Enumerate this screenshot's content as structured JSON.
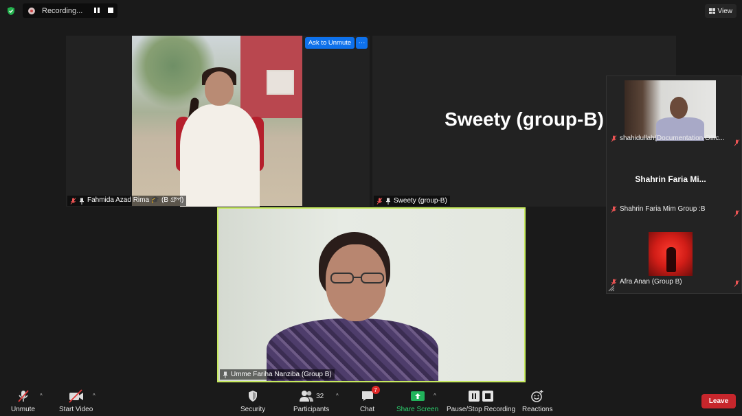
{
  "top_bar": {
    "recording_label": "Recording...",
    "view_label": "View"
  },
  "tiles": {
    "fahmida": {
      "label": "Fahmida Azad Rima 🎓 (B গ্রুপ)"
    },
    "sweety": {
      "display_name": "Sweety (group-B)",
      "label": "Sweety (group-B)"
    },
    "ask_unmute": "Ask to Unmute",
    "more": "···"
  },
  "side_panel": {
    "items": [
      {
        "label": "shahidullah(Documentation Offic..."
      },
      {
        "display_name": "Shahrin Faria Mi...",
        "label": "Shahrin Faria Mim  Group :B"
      },
      {
        "label": "Afra Anan (Group B)"
      }
    ]
  },
  "main_speaker": {
    "label": "Umme Fariha Nanziba (Group B)",
    "border_color": "#c6ea5e"
  },
  "toolbar": {
    "unmute": "Unmute",
    "start_video": "Start Video",
    "security": "Security",
    "participants": "Participants",
    "participant_count": "32",
    "chat": "Chat",
    "chat_badge": "7",
    "share_screen": "Share Screen",
    "pause_stop_recording": "Pause/Stop Recording",
    "reactions": "Reactions",
    "leave": "Leave",
    "leave_color": "#c7262c",
    "share_color": "#21b35b"
  }
}
